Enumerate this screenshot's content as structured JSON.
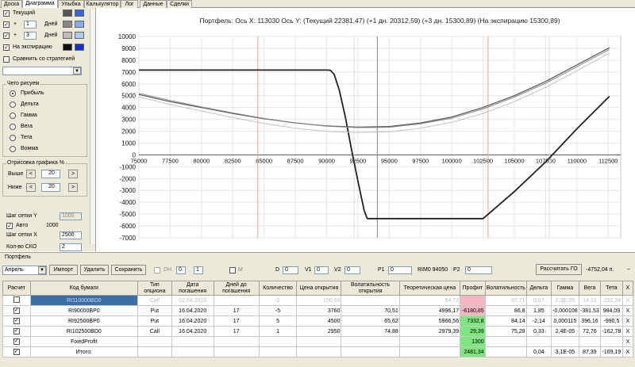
{
  "tabs": [
    "Доска",
    "Диаграмма",
    "Улыбка",
    "Калькулятор",
    "Лог",
    "Данные",
    "Сделки"
  ],
  "left_panel": {
    "current_label": "Текущий",
    "plus1": {
      "value": "1",
      "unit": "Дней"
    },
    "plus3": {
      "value": "3",
      "unit": "Дней"
    },
    "plus_sign": "+",
    "expiry_label": "На экспирацию",
    "compare_label": "Сравнить со стратегией",
    "what_draw_title": "Чего рисуем",
    "radios": [
      "Прибыль",
      "Дельта",
      "Гамма",
      "Вега",
      "Тета",
      "Вомма"
    ],
    "draw_title": "Отрисовка графика %",
    "above_label": "Выше",
    "above_value": "20",
    "below_label": "Ниже",
    "below_value": "20",
    "grid_y_label": "Шаг сетки Y",
    "grid_y_value": "1000",
    "auto_label": "Авто",
    "auto_value": "1000",
    "grid_x_label": "Шаг сетки X",
    "grid_x_value": "2500",
    "sko_label": "Кол-во СКО",
    "sko_value": "2",
    "colors": {
      "current": [
        "#555555",
        "#3366dd"
      ],
      "plus1": [
        "#888888",
        "#88aaee"
      ],
      "plus3": [
        "#bbbbbb",
        "#aaccee"
      ],
      "expiry": [
        "#111111",
        "#1133cc"
      ]
    }
  },
  "chart_data": {
    "type": "line",
    "title": "Портфель: Ось X: 113030 Ось Y:  (Текущий 22381,47)  (+1 дн. 20312,59)  (+3 дн. 15300,89)  (На экспирацию 15300,89)",
    "xlim": [
      75000,
      113500
    ],
    "ylim": [
      -7000,
      10000
    ],
    "xticks": [
      75000,
      77500,
      80000,
      82500,
      85000,
      87500,
      90000,
      92500,
      95000,
      97500,
      100000,
      102500,
      105000,
      107500,
      110000,
      112500
    ],
    "yticks": [
      10000,
      9000,
      8000,
      7000,
      6000,
      5000,
      4000,
      3000,
      2000,
      1000,
      0,
      -1000,
      -2000,
      -3000,
      -4000,
      -5000,
      -6000,
      -7000
    ],
    "cursor_x": 94050,
    "sko_lines": [
      84500,
      102900
    ],
    "vlines": [
      92200,
      107800
    ],
    "series": [
      {
        "x": [
          75000,
          90000,
          90300,
          90600,
          91000,
          91500,
          92000,
          92500,
          93000,
          93250,
          95000,
          100000,
          102500,
          105000,
          107500,
          110000,
          112600
        ],
        "y": [
          7160,
          7160,
          7150,
          6800,
          5500,
          3200,
          400,
          -2200,
          -4700,
          -5380,
          -5380,
          -5380,
          -5380,
          -3100,
          -600,
          2200,
          4950
        ]
      },
      {
        "x": [
          75000,
          77500,
          80000,
          82500,
          85000,
          87500,
          90000,
          92500,
          95000,
          97500,
          100000,
          102500,
          105000,
          107500,
          110000,
          112600
        ],
        "y": [
          5100,
          4500,
          4000,
          3500,
          3050,
          2700,
          2450,
          2350,
          2400,
          2700,
          3200,
          4000,
          5000,
          6200,
          7600,
          9050
        ]
      },
      {
        "x": [
          75000,
          77500,
          80000,
          82500,
          85000,
          87500,
          90000,
          92500,
          95000,
          97500,
          100000,
          102500,
          105000,
          107500,
          110000,
          112600
        ],
        "y": [
          5200,
          4600,
          4050,
          3550,
          3080,
          2700,
          2420,
          2300,
          2330,
          2620,
          3100,
          3880,
          4880,
          6050,
          7450,
          8900
        ]
      },
      {
        "x": [
          75000,
          77500,
          80000,
          82500,
          85000,
          87500,
          90000,
          92500,
          95000,
          97500,
          100000,
          102500,
          105000,
          107500,
          110000,
          112600
        ],
        "y": [
          4900,
          4250,
          3700,
          3150,
          2650,
          2250,
          1980,
          1880,
          1950,
          2250,
          2750,
          3500,
          4500,
          5700,
          7100,
          8600
        ]
      }
    ]
  },
  "portfolio": {
    "section_label": "Портфель",
    "month": "Апрель",
    "import_btn": "Импорт",
    "delete_btn": "Удалить",
    "save_btn": "Сохранить",
    "dh_label": "DH",
    "dh_val1": "0",
    "dh_val2": "1",
    "m_label": "M",
    "d_label": "D",
    "d_value": "0",
    "v1_label": "V1",
    "v1_value": "0",
    "v2_label": "V2",
    "v2_value": "0",
    "p1_label": "P1",
    "p1_value": "0",
    "rim_label": "RIM0 94050",
    "p2_label": "P2",
    "p2_value": "0",
    "calc_btn": "Рассчитать ГО",
    "go_value": "-4752,04 п.",
    "columns": [
      "Расчет",
      "Код бумаги",
      "Тип опциона",
      "Дата погашения",
      "Дней до погашения",
      "Количество",
      "Цена открытия",
      "Волатильность открытия",
      "Теоретическая цена",
      "Профит",
      "Волатильность",
      "Дельта",
      "Гамма",
      "Вега",
      "Тета",
      "X"
    ],
    "rows": [
      {
        "chk": "",
        "code": "RI110000BD0",
        "type": "Call",
        "date": "02.04.2020",
        "days": "",
        "qty": "0",
        "price": "150,00",
        "vol": "",
        "theo": "54,72",
        "profit": "",
        "volat": "97,71",
        "delta": "0,07",
        "gamma": "2,3E-05",
        "vega": "14,12",
        "theta": "-292,34",
        "x": "X",
        "grey": true,
        "profit_color": "#f4b6c2"
      },
      {
        "chk": "✓",
        "code": "RI90000BP0",
        "type": "Put",
        "date": "16.04.2020",
        "days": "17",
        "qty": "-5",
        "price": "3760",
        "vol": "70,51",
        "theo": "4996,17",
        "profit": "-6180,85",
        "volat": "86,8",
        "delta": "1,85",
        "gamma": "-0,000108",
        "vega": "-381,53",
        "theta": "984,09",
        "x": "X",
        "grey": false,
        "profit_color": "#f4b6c2"
      },
      {
        "chk": "✓",
        "code": "RI92500BP0",
        "type": "Put",
        "date": "16.04.2020",
        "days": "17",
        "qty": "5",
        "price": "4500",
        "vol": "65,62",
        "theo": "5966,56",
        "profit": "7332,8",
        "volat": "84,14",
        "delta": "-2,14",
        "gamma": "0,000115",
        "vega": "396,16",
        "theta": "-990,5",
        "x": "X",
        "grey": false,
        "profit_color": "#7ee67e"
      },
      {
        "chk": "✓",
        "code": "RI102500BD0",
        "type": "Call",
        "date": "16.04.2020",
        "days": "17",
        "qty": "1",
        "price": "2950",
        "vol": "74,88",
        "theo": "2979,39",
        "profit": "29,39",
        "volat": "75,29",
        "delta": "0,33",
        "gamma": "2,4E-05",
        "vega": "72,76",
        "theta": "-162,78",
        "x": "X",
        "grey": false,
        "profit_color": "#7ee67e"
      },
      {
        "chk": "✓",
        "code": "FixedProfit",
        "type": "",
        "date": "",
        "days": "",
        "qty": "",
        "price": "",
        "vol": "",
        "theo": "",
        "profit": "1300",
        "volat": "",
        "delta": "",
        "gamma": "",
        "vega": "",
        "theta": "",
        "x": "X",
        "grey": false,
        "profit_color": "#7ee67e"
      },
      {
        "chk": "✓",
        "code": "Итого:",
        "type": "",
        "date": "",
        "days": "",
        "qty": "",
        "price": "",
        "vol": "",
        "theo": "",
        "profit": "2481,34",
        "volat": "",
        "delta": "0,04",
        "gamma": "3,1E-05",
        "vega": "87,39",
        "theta": "-169,19",
        "x": "X",
        "grey": false,
        "profit_color": "#7ee67e"
      }
    ]
  }
}
